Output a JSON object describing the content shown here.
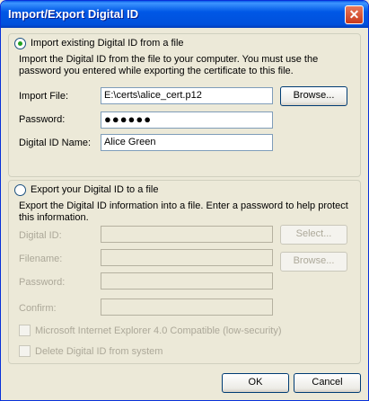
{
  "window": {
    "title": "Import/Export Digital ID",
    "close_label": "✕"
  },
  "import": {
    "option_label": "Import existing Digital ID from a file",
    "selected": true,
    "description": "Import the Digital ID from the file to your computer. You must use the password you entered while exporting the certificate to this file.",
    "import_file_label": "Import File:",
    "import_file_value": "E:\\certs\\alice_cert.p12",
    "browse_label": "Browse...",
    "password_label": "Password:",
    "password_value": "●●●●●●",
    "name_label": "Digital ID Name:",
    "name_value": "Alice Green"
  },
  "export": {
    "option_label": "Export your Digital ID to a file",
    "selected": false,
    "description": "Export the Digital ID information into a file. Enter a password to help protect this information.",
    "digital_id_label": "Digital ID:",
    "select_label": "Select...",
    "filename_label": "Filename:",
    "browse_label": "Browse...",
    "password_label": "Password:",
    "confirm_label": "Confirm:",
    "ie_compat_label": "Microsoft Internet Explorer 4.0 Compatible (low-security)",
    "delete_label": "Delete Digital ID from system"
  },
  "buttons": {
    "ok_label": "OK",
    "cancel_label": "Cancel"
  },
  "colors": {
    "titlebar": "#0058e6",
    "dialog_bg": "#ece9d8",
    "radio_dot": "#21a121"
  }
}
